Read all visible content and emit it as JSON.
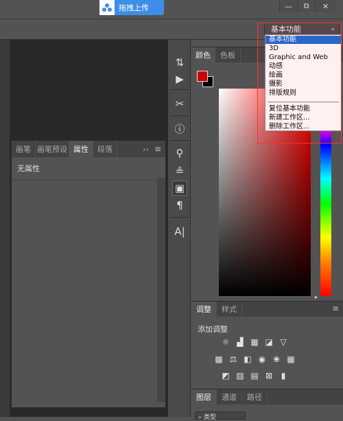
{
  "topbar": {
    "upload_label": "拖拽上传"
  },
  "window": {
    "minimize": "—",
    "restore": "⧉",
    "close": "✕"
  },
  "workspace": {
    "selected": "基本功能",
    "menu_items": [
      "基本功能",
      "3D",
      "Graphic and Web",
      "动感",
      "绘画",
      "摄影",
      "排版规则"
    ],
    "menu_actions": [
      "复位基本功能",
      "新建工作区...",
      "删除工作区..."
    ]
  },
  "collapse_arrows": "««",
  "props_panel": {
    "tabs": [
      "画笔",
      "画笔预设",
      "属性",
      "段落"
    ],
    "active_tab": 2,
    "content_label": "无属性",
    "menu_glyph": "≡",
    "more_glyph": "››"
  },
  "color_panel": {
    "tabs": [
      "颜色",
      "色板"
    ],
    "active_tab": 0,
    "foreground": "#cc0000",
    "background": "#000000"
  },
  "adjust_panel": {
    "tabs": [
      "调整",
      "样式"
    ],
    "active_tab": 0,
    "add_label": "添加调整"
  },
  "layers_panel": {
    "tabs": [
      "图层",
      "通道",
      "路径"
    ],
    "active_tab": 0,
    "filter_label": "类型"
  },
  "colors": {
    "accent": "#3d8ee6",
    "highlight": "#ff3030",
    "menu_selected": "#1a6bd6"
  }
}
